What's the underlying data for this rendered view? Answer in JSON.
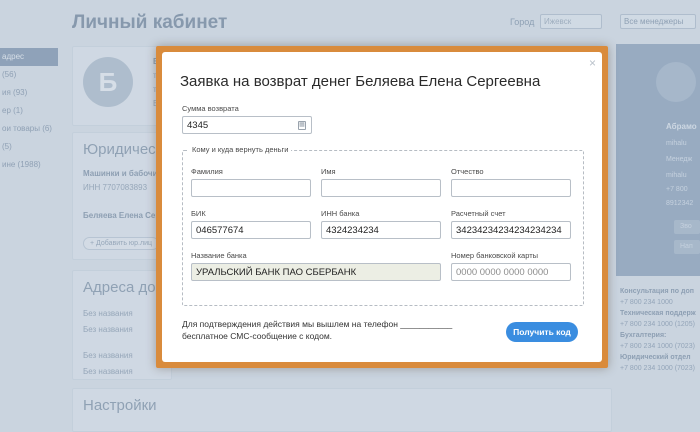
{
  "page": {
    "title": "Личный кабинет",
    "city_label": "Город",
    "city_value": "Ижевск",
    "manager_select": "Все менеджеры"
  },
  "sidebar": {
    "items": [
      "адрес",
      "(56)",
      "ия (93)",
      "ер (1)",
      "ои товары (6)",
      "(5)",
      "ине (1988)"
    ]
  },
  "profile": {
    "avatar_letter": "Б",
    "l1": "Б",
    "l2": "т",
    "l3": "т",
    "l4": "Е"
  },
  "legal": {
    "heading": "Юридическ",
    "company": "Машинки и бабочи",
    "inn": "ИНН 7707083893",
    "person": "Беляева Елена Серге",
    "add_link": "+ Добавить юр.лиц"
  },
  "addresses": {
    "heading": "Адреса дост",
    "row1": "Без названия",
    "row2": "Без названия",
    "row3": "Без названия",
    "row4": "Без названия"
  },
  "settings": {
    "heading": "Настройки"
  },
  "manager": {
    "name": "Абрамо",
    "line1": "Менедж",
    "line2": "mihalu",
    "line3": "mihalu",
    "line4": "+7 800",
    "line5": "8912342",
    "line6": "Зво",
    "line7": "Нап"
  },
  "contacts": [
    {
      "bold": true,
      "text": "Консультация по доп"
    },
    {
      "bold": false,
      "text": "+7 800 234 1000"
    },
    {
      "bold": true,
      "text": "Техническая поддерж"
    },
    {
      "bold": false,
      "text": "+7 800 234 1000 (1205)"
    },
    {
      "bold": true,
      "text": "Бухгалтерия:"
    },
    {
      "bold": false,
      "text": "+7 800 234 1000 (7023)"
    },
    {
      "bold": true,
      "text": "Юридический отдел"
    },
    {
      "bold": false,
      "text": "+7 800 234 1000 (7023)"
    }
  ],
  "modal": {
    "title": "Заявка на возврат денег Беляева Елена Сергеевна",
    "close": "×",
    "amount_label": "Сумма возврата",
    "amount_value": "4345",
    "legend": "Кому и куда вернуть деньги",
    "surname_label": "Фамилия",
    "surname_value": "",
    "name_label": "Имя",
    "name_value": "",
    "patronymic_label": "Отчество",
    "patronymic_value": "",
    "bik_label": "БИК",
    "bik_value": "046577674",
    "bank_inn_label": "ИНН банка",
    "bank_inn_value": "4324234234",
    "account_label": "Расчетный счет",
    "account_value": "34234234234234234234",
    "bank_name_label": "Название банка",
    "bank_name_value": "УРАЛЬСКИЙ БАНК ПАО СБЕРБАНК",
    "card_label": "Номер банковской карты",
    "card_placeholder": "0000 0000 0000 0000",
    "sms_line1": "Для подтверждения действия мы вышлем на телефон ___________",
    "sms_line2": "бесплатное СМС-сообщение с кодом.",
    "get_code_button": "Получить код"
  }
}
